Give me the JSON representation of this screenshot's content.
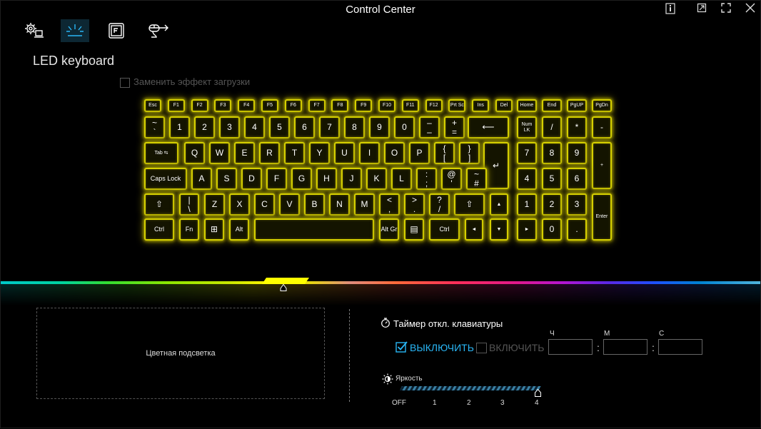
{
  "window": {
    "title": "Control Center",
    "buttons": [
      {
        "name": "info-icon",
        "glyph": "🛈"
      },
      {
        "name": "restore-icon",
        "glyph": "⤢"
      },
      {
        "name": "maximize-icon",
        "glyph": "⛶"
      },
      {
        "name": "close-icon",
        "glyph": "✕"
      }
    ]
  },
  "tabs": [
    {
      "name": "system-settings-tab",
      "icon": "gear-laptop-icon",
      "active": false
    },
    {
      "name": "led-keyboard-tab",
      "icon": "led-light-icon",
      "active": true
    },
    {
      "name": "function-key-tab",
      "icon": "f-key-icon",
      "active": false
    },
    {
      "name": "mouse-tab",
      "icon": "mouse-icon",
      "active": false
    }
  ],
  "page": {
    "title": "LED keyboard",
    "boot_effect_label": "Заменить эффект загрузки"
  },
  "keyboard": {
    "glow_color": "#d6d000",
    "rows": [
      [
        "Esc",
        "F1",
        "F2",
        "F3",
        "F4",
        "F5",
        "F6",
        "F7",
        "F8",
        "F9",
        "F10",
        "F11",
        "F12",
        "Prt Sc",
        "Ins",
        "Del",
        "Home",
        "End",
        "PgUP",
        "PgDn"
      ],
      [
        "~\n`",
        "1",
        "2",
        "3",
        "4",
        "5",
        "6",
        "7",
        "8",
        "9",
        "0",
        "–\n–",
        "+\n=",
        "⟵",
        "Num LK",
        "/",
        "*",
        "-"
      ],
      [
        "Tab ⇆",
        "Q",
        "W",
        "E",
        "R",
        "T",
        "Y",
        "U",
        "I",
        "O",
        "P",
        "{\n[",
        "}\n]",
        "↵",
        "7",
        "8",
        "9",
        "+"
      ],
      [
        "Caps Lock",
        "A",
        "S",
        "D",
        "F",
        "G",
        "H",
        "J",
        "K",
        "L",
        ":\n;",
        "@\n'",
        "~\n#",
        "4",
        "5",
        "6"
      ],
      [
        "⇧",
        "|\n\\",
        "Z",
        "X",
        "C",
        "V",
        "B",
        "N",
        "M",
        "<\n,",
        ">\n.",
        "?\n/",
        "⇧",
        "▲",
        "1",
        "2",
        "3",
        "Enter"
      ],
      [
        "Ctrl",
        "Fn",
        "⊞",
        "Alt",
        "",
        "Alt Gr",
        "▤",
        "Ctrl",
        "◄",
        "▼",
        "►",
        "0",
        "."
      ]
    ]
  },
  "spectrum": {
    "selected_color": "#ffff00",
    "position": 0.37
  },
  "color_panel": {
    "label": "Цветная подсветка"
  },
  "timer": {
    "title": "Таймер откл. клавиатуры",
    "off_label": "ВЫКЛЮЧИТЬ",
    "on_label": "ВКЛЮЧИТЬ",
    "off_checked": true,
    "on_checked": false,
    "hour_label": "Ч",
    "minute_label": "М",
    "second_label": "С",
    "hour_value": "",
    "minute_value": "",
    "second_value": ""
  },
  "brightness": {
    "label": "Яркость",
    "value": 4,
    "ticks": [
      "OFF",
      "1",
      "2",
      "3",
      "4"
    ]
  }
}
